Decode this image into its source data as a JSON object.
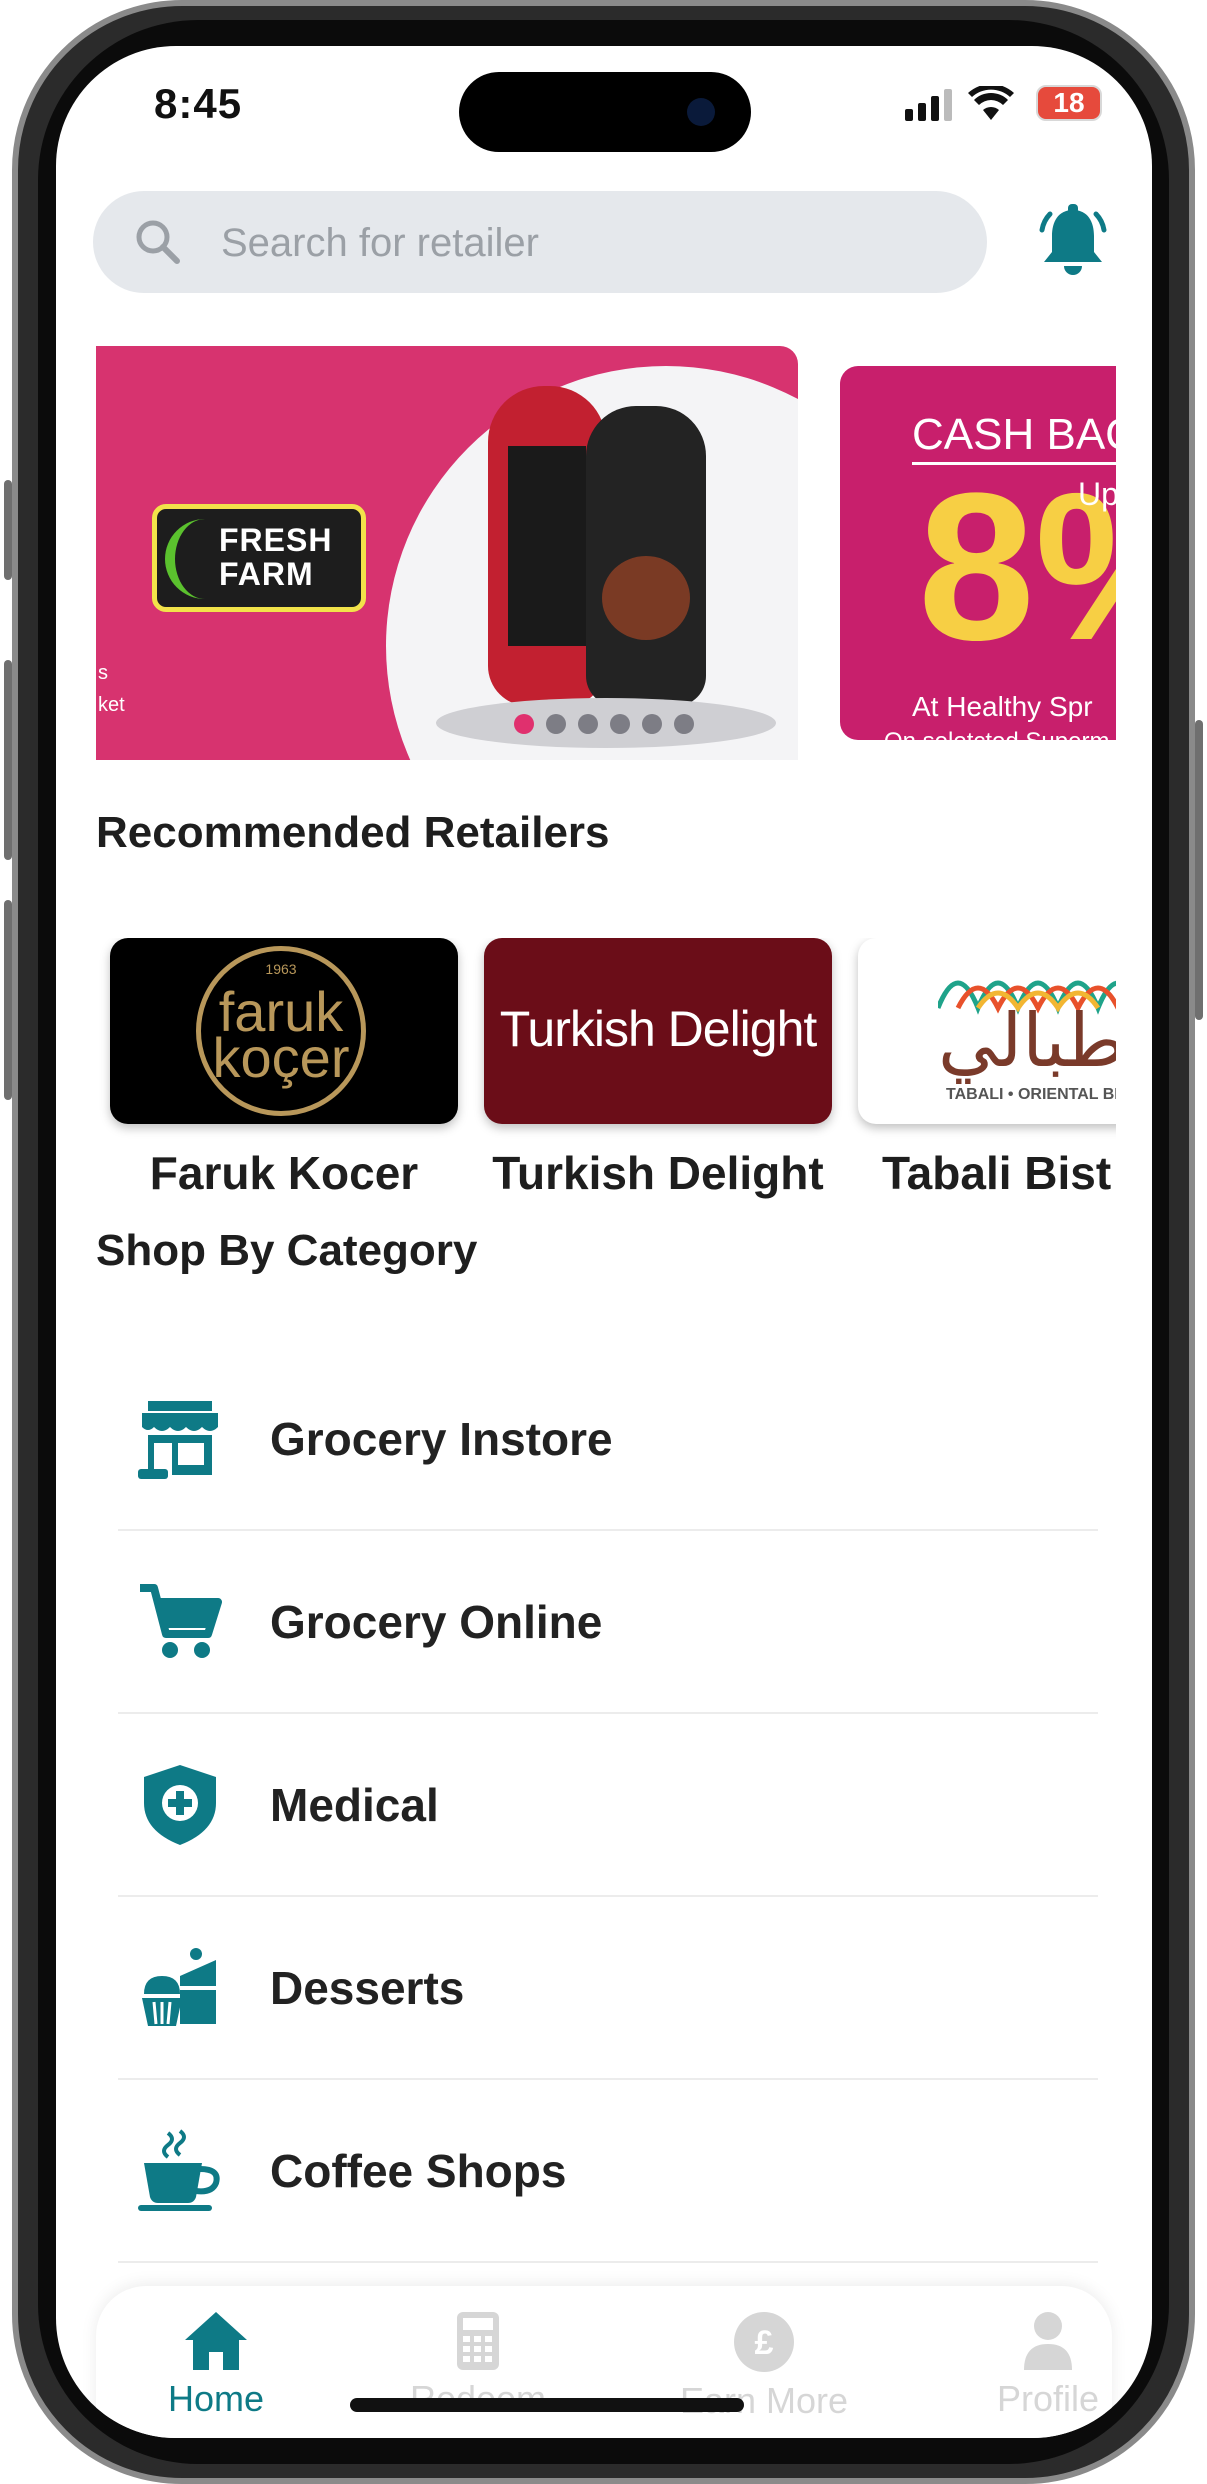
{
  "status": {
    "time": "8:45",
    "battery": "18"
  },
  "search": {
    "placeholder": "Search for retailer"
  },
  "banners": [
    {
      "brand": "FRESH FARM"
    },
    {
      "title": "CASH BAC",
      "up": "Up",
      "amount": "8%",
      "at": "At Healthy Spr",
      "note": "On seletcted Superm"
    }
  ],
  "carousel": {
    "dot_count": 6,
    "active_index": 0
  },
  "recommended": {
    "title": "Recommended Retailers",
    "items": [
      {
        "name": "Faruk Kocer",
        "logo_text": "faruk koçer",
        "logo_year": "1963"
      },
      {
        "name": "Turkish Delight",
        "logo_text": "Turkish Delight"
      },
      {
        "name": "Tabali Bist",
        "logo_text": "طبالي",
        "logo_sub": "TABALI • ORIENTAL BISTR"
      }
    ]
  },
  "categories": {
    "title": "Shop By Category",
    "items": [
      {
        "label": "Grocery Instore",
        "icon": "store-icon"
      },
      {
        "label": "Grocery Online",
        "icon": "cart-icon"
      },
      {
        "label": "Medical",
        "icon": "medical-shield-icon"
      },
      {
        "label": "Desserts",
        "icon": "cake-icon"
      },
      {
        "label": "Coffee Shops",
        "icon": "coffee-cup-icon"
      }
    ]
  },
  "nav": {
    "items": [
      {
        "label": "Home",
        "icon": "home-icon",
        "active": true
      },
      {
        "label": "Redeem",
        "icon": "calculator-icon",
        "active": false
      },
      {
        "label": "Earn More",
        "icon": "pound-coin-icon",
        "active": false
      },
      {
        "label": "Profile",
        "icon": "user-icon",
        "active": false
      }
    ]
  },
  "colors": {
    "accent": "#0e7a86",
    "banner_pink": "#d7336f",
    "inactive": "#d6d6d6"
  }
}
